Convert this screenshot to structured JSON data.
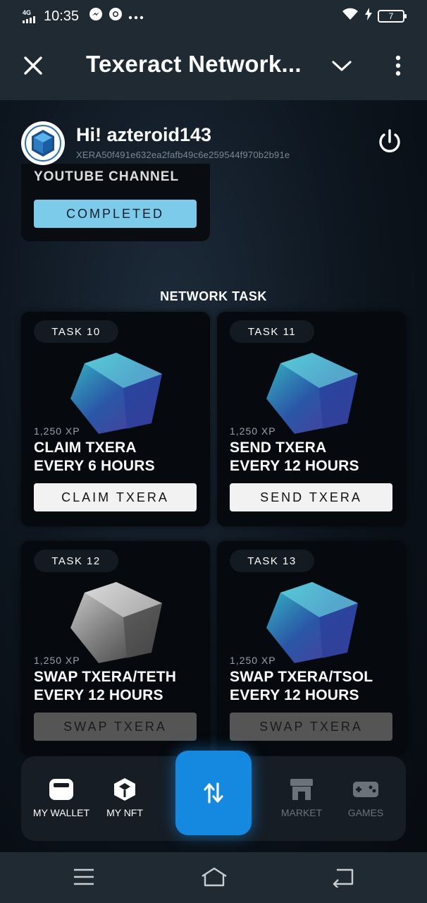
{
  "status_bar": {
    "network": "4G",
    "time": "10:35",
    "battery": "7"
  },
  "app_bar": {
    "title": "Texeract Network..."
  },
  "profile": {
    "greeting": "Hi! azteroid143",
    "address": "XERA50f491e632ea2fafb49c6e259544f970b2b91e"
  },
  "previous_task": {
    "title_fragment": "YOUTUBE CHANNEL",
    "button": "COMPLETED"
  },
  "section_title": "NETWORK TASK",
  "tasks": [
    {
      "label": "TASK 10",
      "xp": "1,250 XP",
      "line1": "CLAIM TXERA",
      "line2": "EVERY 6 HOURS",
      "button": "CLAIM TXERA",
      "enabled": true,
      "cube": "color"
    },
    {
      "label": "TASK 11",
      "xp": "1,250 XP",
      "line1": "SEND TXERA",
      "line2": "EVERY 12 HOURS",
      "button": "SEND TXERA",
      "enabled": true,
      "cube": "color"
    },
    {
      "label": "TASK 12",
      "xp": "1,250 XP",
      "line1": "SWAP TXERA/TETH",
      "line2": "EVERY 12 HOURS",
      "button": "SWAP TXERA",
      "enabled": false,
      "cube": "gray"
    },
    {
      "label": "TASK 13",
      "xp": "1,250 XP",
      "line1": "SWAP TXERA/TSOL",
      "line2": "EVERY 12 HOURS",
      "button": "SWAP TXERA",
      "enabled": false,
      "cube": "color"
    }
  ],
  "bottom_nav": {
    "my_wallet": "MY WALLET",
    "my_nft": "MY NFT",
    "market": "MARKET",
    "games": "GAMES"
  },
  "colors": {
    "accent": "#1588e0",
    "completed": "#7ccbea",
    "bar": "#1f2a33"
  }
}
